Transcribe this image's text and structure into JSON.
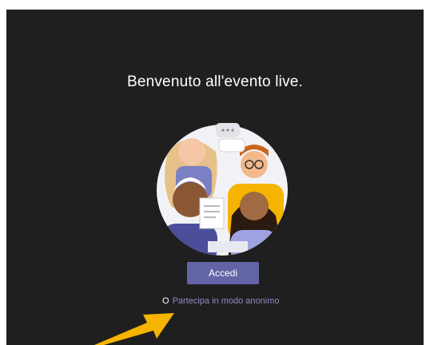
{
  "welcome": {
    "title": "Benvenuto all'evento live."
  },
  "actions": {
    "signin_label": "Accedi",
    "anon_prefix": "O",
    "anon_link": "Partecipa in modo anonimo"
  },
  "illustration": {
    "name": "people-illustration",
    "arrow_color": "#f4b400"
  },
  "colors": {
    "background": "#201f1f",
    "accent": "#6264a7",
    "link": "#8b8cc7"
  }
}
